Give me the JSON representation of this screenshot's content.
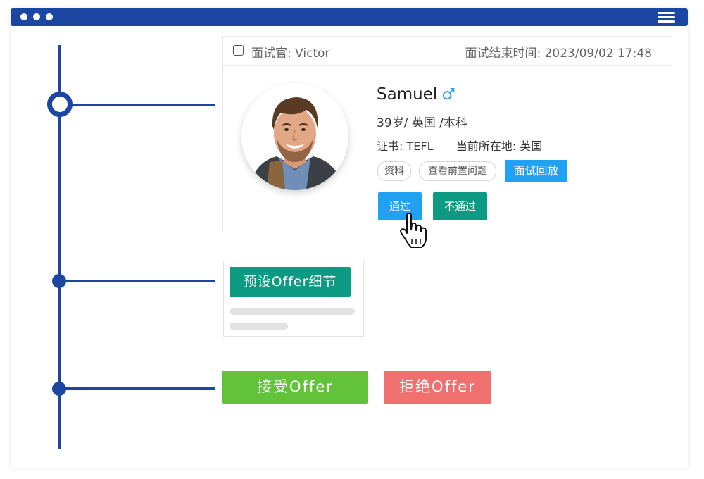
{
  "interview_card": {
    "interviewer_label": "面试官:",
    "interviewer_name": "Victor",
    "end_time_label": "面试结束时间:",
    "end_time": "2023/09/02 17:48",
    "candidate": {
      "name": "Samuel",
      "gender_icon": "male-icon",
      "gender_symbol": "♂",
      "details": "39岁/ 英国  /本科",
      "certificate_label": "证书:",
      "certificate": "TEFL",
      "location_label": "当前所在地:",
      "location": "英国"
    },
    "tags": [
      "资料",
      "查看前置问题"
    ],
    "replay_label": "面试回放",
    "pass_label": "通过",
    "fail_label": "不通过"
  },
  "offer_detail": {
    "button_label": "预设Offer细节"
  },
  "offer_actions": {
    "accept_label": "接受Offer",
    "reject_label": "拒绝Offer"
  },
  "colors": {
    "brand_blue": "#1b47a3",
    "accent_blue": "#21a1f1",
    "teal": "#0d9a82",
    "green": "#62c23a",
    "red": "#f07070"
  }
}
